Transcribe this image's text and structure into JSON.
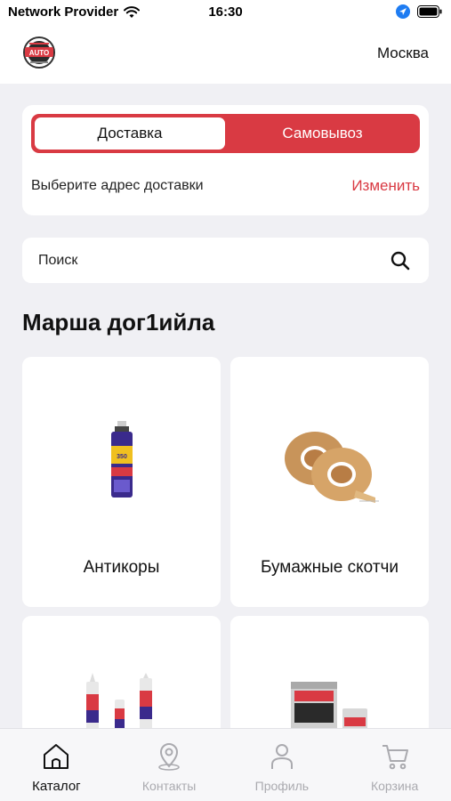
{
  "status_bar": {
    "carrier": "Network Provider",
    "time": "16:30"
  },
  "header": {
    "logo_text": "AUTO",
    "city": "Москва"
  },
  "delivery": {
    "options": [
      "Доставка",
      "Самовывоз"
    ],
    "selected": "Доставка",
    "address_prompt": "Выберите адрес доставки",
    "change_label": "Изменить"
  },
  "search": {
    "placeholder": "Поиск"
  },
  "section_title": "Марша дог1ийла",
  "categories": [
    {
      "name": "Антикоры"
    },
    {
      "name": "Бумажные скотчи"
    },
    {
      "name": ""
    },
    {
      "name": ""
    }
  ],
  "tabs": [
    {
      "label": "Каталог",
      "icon": "home-icon",
      "active": true
    },
    {
      "label": "Контакты",
      "icon": "location-pin-icon",
      "active": false
    },
    {
      "label": "Профиль",
      "icon": "person-icon",
      "active": false
    },
    {
      "label": "Корзина",
      "icon": "cart-icon",
      "active": false
    }
  ],
  "colors": {
    "accent": "#d93a43",
    "background": "#f0f0f4",
    "tab_inactive": "#aaaaaf"
  }
}
